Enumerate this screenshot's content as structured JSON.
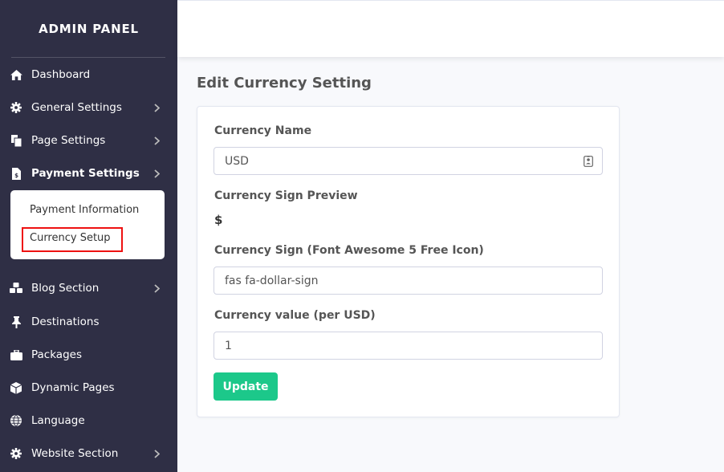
{
  "sidebar": {
    "brand": "ADMIN PANEL",
    "items": [
      {
        "label": "Dashboard",
        "icon": "home-icon",
        "has_children": false
      },
      {
        "label": "General Settings",
        "icon": "gear-icon",
        "has_children": true
      },
      {
        "label": "Page Settings",
        "icon": "copy-icon",
        "has_children": true
      },
      {
        "label": "Payment Settings",
        "icon": "file-invoice-dollar-icon",
        "has_children": true,
        "active": true
      },
      {
        "label": "Blog Section",
        "icon": "cubes-icon",
        "has_children": true
      },
      {
        "label": "Destinations",
        "icon": "thumbtack-icon",
        "has_children": false
      },
      {
        "label": "Packages",
        "icon": "suitcase-icon",
        "has_children": false
      },
      {
        "label": "Dynamic Pages",
        "icon": "cube-icon",
        "has_children": false
      },
      {
        "label": "Language",
        "icon": "globe-icon",
        "has_children": false
      },
      {
        "label": "Website Section",
        "icon": "gear-icon",
        "has_children": true
      }
    ],
    "submenu": {
      "items": [
        "Payment Information",
        "Currency Setup"
      ],
      "highlighted": "Currency Setup"
    }
  },
  "main": {
    "title": "Edit Currency Setting",
    "form": {
      "currency_name_label": "Currency Name",
      "currency_name_value": "USD",
      "sign_preview_label": "Currency Sign Preview",
      "sign_preview_value": "$",
      "currency_sign_label": "Currency Sign (Font Awesome 5 Free Icon)",
      "currency_sign_value": "fas fa-dollar-sign",
      "currency_value_label": "Currency value (per USD)",
      "currency_value_value": "1",
      "submit_label": "Update"
    }
  },
  "colors": {
    "sidebar_bg": "#2f2f45",
    "page_bg": "#f8f9fc",
    "accent_green": "#1cc88a",
    "highlight_red": "#ee1111"
  }
}
